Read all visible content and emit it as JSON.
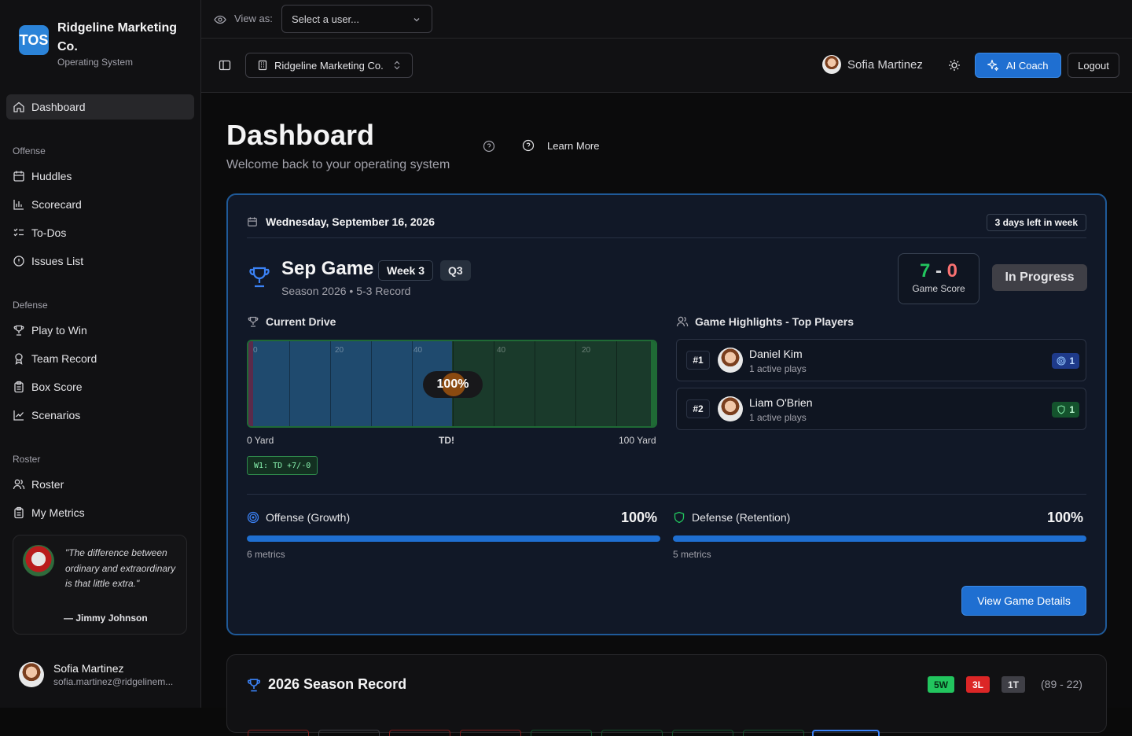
{
  "viewer": {
    "label": "View as:",
    "placeholder": "Select a user..."
  },
  "org": {
    "name": "Ridgeline Marketing Co.",
    "logo": "TOS",
    "subtitle": "Operating System",
    "switcher": "Ridgeline Marketing Co."
  },
  "sidebar": {
    "active": "Dashboard",
    "groups": [
      {
        "label": "Offense",
        "items": [
          "Huddles",
          "Scorecard",
          "To-Dos",
          "Issues List"
        ]
      },
      {
        "label": "Defense",
        "items": [
          "Play to Win",
          "Team Record",
          "Box Score",
          "Scenarios"
        ]
      },
      {
        "label": "Roster",
        "items": [
          "Roster",
          "My Metrics"
        ]
      }
    ]
  },
  "quote": {
    "text": "\"The difference between ordinary and extraordinary is that little extra.\"",
    "author": "— Jimmy Johnson"
  },
  "user": {
    "name": "Sofia Martinez",
    "email": "sofia.martinez@ridgelinem..."
  },
  "topbar": {
    "ai_coach": "AI Coach",
    "logout": "Logout"
  },
  "page": {
    "title": "Dashboard",
    "subtitle": "Welcome back to your operating system",
    "learn_more": "Learn More"
  },
  "game": {
    "date": "Wednesday, September 16, 2026",
    "days_left": "3 days left in week",
    "title": "Sep Game",
    "week": "Week 3",
    "quarter": "Q3",
    "season": "Season 2026 • 5-3 Record",
    "score_home": "7",
    "score_sep": "-",
    "score_away": "0",
    "score_label": "Game Score",
    "status": "In Progress",
    "drive_label": "Current Drive",
    "drive_pct": "100%",
    "drive_progress": 0.5,
    "yard_start": "0 Yard",
    "td": "TD!",
    "yard_end": "100 Yard",
    "yard_marks": [
      "0",
      "20",
      "40",
      "40",
      "20"
    ],
    "drive_chip": "W1: TD +7/-0",
    "highlights_label": "Game Highlights - Top Players",
    "players": [
      {
        "rank": "#1",
        "name": "Daniel Kim",
        "meta": "1 active plays",
        "badge": "1"
      },
      {
        "rank": "#2",
        "name": "Liam O'Brien",
        "meta": "1 active plays",
        "badge": "1"
      }
    ],
    "offense": {
      "label": "Offense (Growth)",
      "pct": "100%",
      "fill": 1.0,
      "count": "6 metrics"
    },
    "defense": {
      "label": "Defense (Retention)",
      "pct": "100%",
      "fill": 1.0,
      "count": "5 metrics"
    },
    "details_button": "View Game Details"
  },
  "season": {
    "title": "2026 Season Record",
    "wins": "5W",
    "losses": "3L",
    "ties": "1T",
    "points": "(89 - 22)"
  },
  "colors": {
    "accent": "#1f6fd1",
    "win": "#22c55e",
    "loss": "#dc2626",
    "offense": "#3b82f6",
    "defense": "#22c55e"
  }
}
